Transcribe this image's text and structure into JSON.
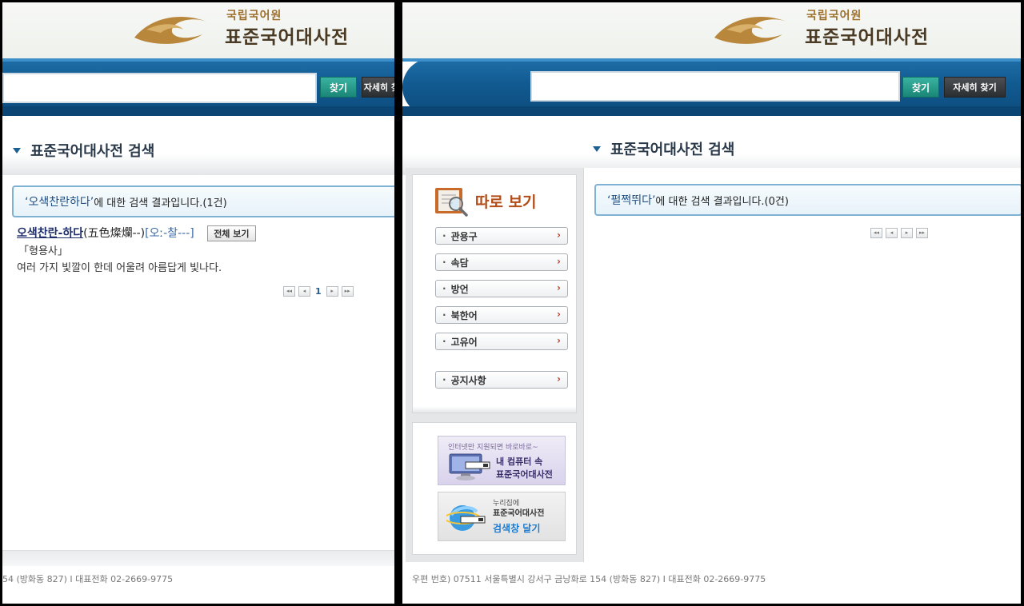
{
  "header": {
    "org": "국립국어원",
    "title": "표준국어대사전",
    "find_label": "찾기",
    "detail_label": "자세히 찾기",
    "left_search_value": "",
    "right_search_value": ""
  },
  "section": {
    "title": "표준국어대사전 검색"
  },
  "left": {
    "result_term": "‘오색찬란하다’",
    "result_suffix": "에 대한 검색 결과입니다.(1건)",
    "entry": {
      "word": "오색찬란-하다",
      "hanja": "(五色燦爛--)",
      "pron": "[오ː-찰---]",
      "full_view_label": "전체 보기",
      "pos": "「형용사」",
      "definition": "여러 가지 빛깔이 한데 어울려 아름답게 빛나다."
    },
    "pager": {
      "first": "◂◂",
      "prev": "◂",
      "page": "1",
      "next": "▸",
      "last": "▸▸"
    },
    "footer": "54 (방화동  827)  I  대표전화  02-2669-9775"
  },
  "right": {
    "result_term": "‘펄쩍뛰다’",
    "result_suffix": "에 대한 검색 결과입니다.(0건)",
    "pager": {
      "first": "◂◂",
      "prev": "◂",
      "next": "▸",
      "last": "▸▸"
    },
    "sidebar": {
      "title": "따로 보기",
      "items": [
        {
          "label": "관용구",
          "arrow": "›"
        },
        {
          "label": "속담",
          "arrow": "›"
        },
        {
          "label": "방언",
          "arrow": "›"
        },
        {
          "label": "북한어",
          "arrow": "›"
        },
        {
          "label": "고유어",
          "arrow": "›"
        },
        {
          "label": "공지사항",
          "arrow": "›"
        }
      ],
      "dot": "·"
    },
    "promo1": {
      "line1": "인터넷만 지원되면 바로바로~",
      "line2": "내 컴퓨터 속",
      "line3": "표준국어대사전"
    },
    "promo2": {
      "line1": "누리집에",
      "line2": "표준국어대사전",
      "line3": "검색창 달기"
    },
    "footer": "우편 번호) 07511 서울특별시 강서구 금낭화로 154 (방화동  827)  I  대표전화  02-2669-9775"
  },
  "colors": {
    "bar_blue": "#115a91",
    "accent_teal": "#1a8676",
    "title_brown": "#4a3a23",
    "side_orange": "#b24d18"
  }
}
